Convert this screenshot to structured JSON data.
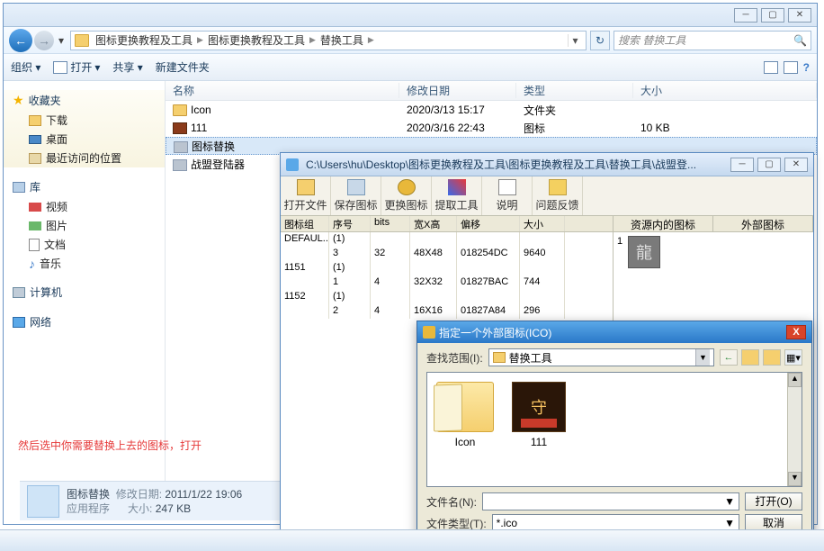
{
  "explorer": {
    "nav": {
      "back": "←",
      "fwd": "→",
      "drop": "▾",
      "refresh": "↻"
    },
    "breadcrumbs": [
      "图标更换教程及工具",
      "图标更换教程及工具",
      "替换工具"
    ],
    "search_placeholder": "搜索 替换工具",
    "cmdbar": {
      "org": "组织 ▾",
      "open": "打开",
      "share": "共享 ▾",
      "new": "新建文件夹"
    },
    "columns": {
      "name": "名称",
      "date": "修改日期",
      "type": "类型",
      "size": "大小"
    },
    "rows": [
      {
        "name": "Icon",
        "date": "2020/3/13 15:17",
        "type": "文件夹",
        "size": "",
        "icon": "f-fold"
      },
      {
        "name": "111",
        "date": "2020/3/16 22:43",
        "type": "图标",
        "size": "10 KB",
        "icon": "f-111"
      },
      {
        "name": "图标替换",
        "date": "",
        "type": "",
        "size": "",
        "icon": "f-app",
        "sel": true
      },
      {
        "name": "战盟登陆器",
        "date": "",
        "type": "",
        "size": "",
        "icon": "f-app"
      }
    ],
    "sidebar": {
      "fav": "收藏夹",
      "fav_items": [
        "下载",
        "桌面",
        "最近访问的位置"
      ],
      "lib": "库",
      "lib_items": [
        "视频",
        "图片",
        "文档",
        "音乐"
      ],
      "computer": "计算机",
      "network": "网络"
    },
    "status": {
      "name": "图标替换",
      "date_lbl": "修改日期:",
      "date": "2011/1/22 19:06",
      "type": "应用程序",
      "size_lbl": "大小:",
      "size": "247 KB"
    }
  },
  "annotation": "然后选中你需要替换上去的图标，打开",
  "win2": {
    "title": "C:\\Users\\hu\\Desktop\\图标更换教程及工具\\图标更换教程及工具\\替换工具\\战盟登...",
    "buttons": [
      "打开文件",
      "保存图标",
      "更换图标",
      "提取工具",
      "说明",
      "问题反馈"
    ],
    "gridcols": [
      "图标组",
      "序号",
      "bits",
      "宽X高",
      "偏移",
      "大小"
    ],
    "gridrows": [
      [
        "DEFAUL..",
        "(1)",
        "",
        "",
        "",
        ""
      ],
      [
        "",
        "3",
        "32",
        "48X48",
        "018254DC",
        "9640"
      ],
      [
        "1151",
        "(1)",
        "",
        "",
        "",
        ""
      ],
      [
        "",
        "1",
        "4",
        "32X32",
        "01827BAC",
        "744"
      ],
      [
        "1152",
        "(1)",
        "",
        "",
        "",
        ""
      ],
      [
        "",
        "2",
        "4",
        "16X16",
        "01827A84",
        "296"
      ]
    ],
    "res_in": "资源内的图标",
    "res_out": "外部图标",
    "res_glyph": "龍"
  },
  "win3": {
    "title": "指定一个外部图标(ICO)",
    "scope_lbl": "查找范围(I):",
    "scope_val": "替换工具",
    "items": [
      {
        "label": "Icon",
        "kind": "folder"
      },
      {
        "label": "111",
        "kind": "icon"
      }
    ],
    "fname_lbl": "文件名(N):",
    "fname_val": "",
    "ftype_lbl": "文件类型(T):",
    "ftype_val": "*.ico",
    "open": "打开(O)",
    "cancel": "取消"
  }
}
